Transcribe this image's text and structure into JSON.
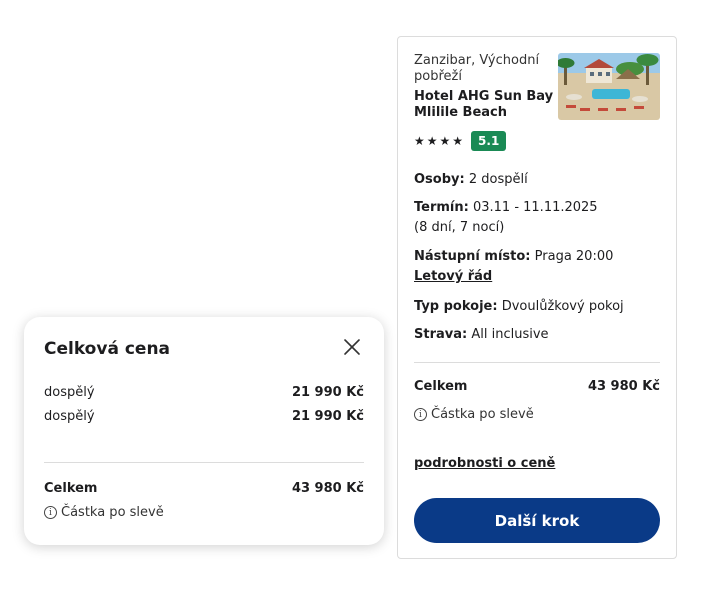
{
  "summary": {
    "location": "Zanzibar, Východní pobřeží",
    "hotel_name": "Hotel AHG Sun Bay Mlilile Beach",
    "stars": "★★★★",
    "star_count": 4,
    "score": "5.1",
    "persons_label": "Osoby:",
    "persons_value": "2 dospělí",
    "term_label": "Termín:",
    "term_value": "03.11 - 11.11.2025",
    "term_duration": "(8 dní, 7 nocí)",
    "departure_label": "Nástupní místo:",
    "departure_value": "Praga 20:00",
    "flight_schedule_link": "Letový řád",
    "room_label": "Typ pokoje:",
    "room_value": "Dvoulůžkový pokoj",
    "board_label": "Strava:",
    "board_value": "All inclusive",
    "total_label": "Celkem",
    "total_value": "43 980 Kč",
    "after_discount": "Částka po slevě",
    "price_details_link": "podrobnosti o ceně",
    "next_button": "Další krok"
  },
  "popover": {
    "title": "Celková cena",
    "lines": [
      {
        "label": "dospělý",
        "amount": "21 990 Kč"
      },
      {
        "label": "dospělý",
        "amount": "21 990 Kč"
      }
    ],
    "total_label": "Celkem",
    "total_value": "43 980 Kč",
    "after_discount": "Částka po slevě"
  },
  "colors": {
    "primary_button": "#0a3a87",
    "score_badge": "#1a8a55"
  }
}
